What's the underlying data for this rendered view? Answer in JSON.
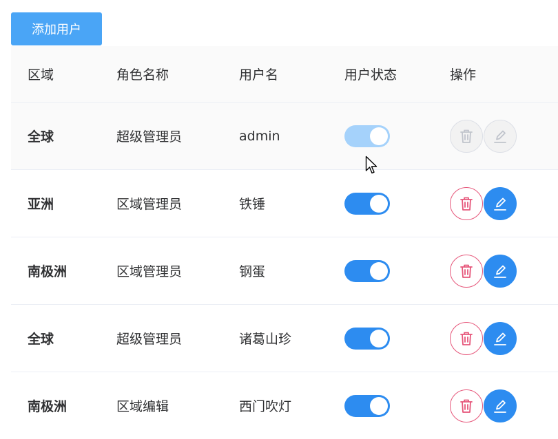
{
  "add_button_label": "添加用户",
  "columns": {
    "region": "区域",
    "role": "角色名称",
    "username": "用户名",
    "status": "用户状态",
    "actions": "操作"
  },
  "rows": [
    {
      "region": "全球",
      "role": "超级管理员",
      "username": "admin",
      "enabled": true,
      "disabled": true
    },
    {
      "region": "亚洲",
      "role": "区域管理员",
      "username": "铁锤",
      "enabled": true,
      "disabled": false
    },
    {
      "region": "南极洲",
      "role": "区域管理员",
      "username": "钢蛋",
      "enabled": true,
      "disabled": false
    },
    {
      "region": "全球",
      "role": "超级管理员",
      "username": "诸葛山珍",
      "enabled": true,
      "disabled": false
    },
    {
      "region": "南极洲",
      "role": "区域编辑",
      "username": "西门吹灯",
      "enabled": true,
      "disabled": false
    }
  ],
  "colors": {
    "primary": "#2d8cf0",
    "primary_light": "#a5d2fb",
    "add_button": "#4aa5f6",
    "danger": "#e6567a",
    "disabled_icon": "#c0c4cc"
  },
  "icons": {
    "delete": "trash-icon",
    "edit": "pencil-icon",
    "cursor": "mouse-pointer-icon"
  }
}
